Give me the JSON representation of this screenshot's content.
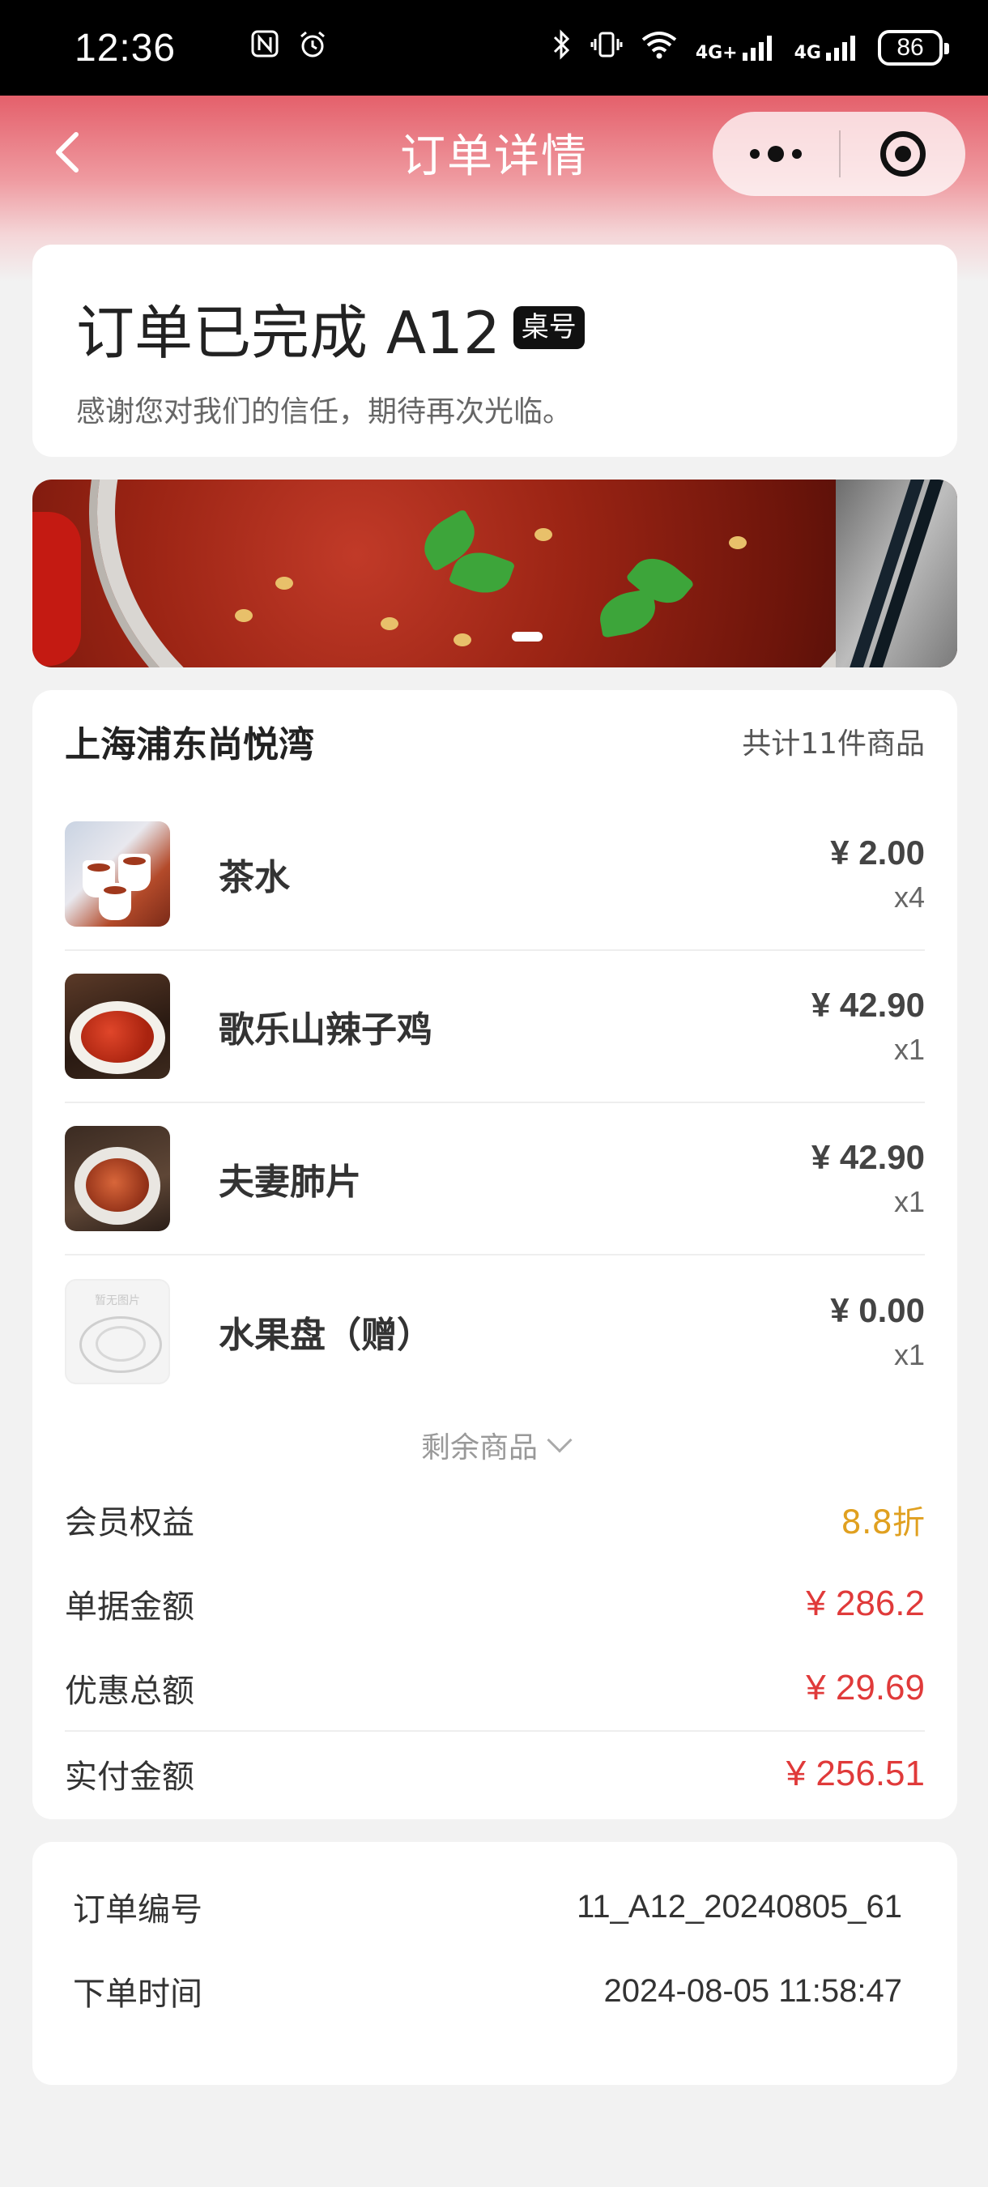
{
  "status_bar": {
    "time": "12:36",
    "battery": "86",
    "signal_labels": [
      "4G+",
      "4G"
    ],
    "icons": [
      "nfc-icon",
      "alarm-icon",
      "bluetooth-icon",
      "vibrate-icon",
      "wifi-icon",
      "signal-icon",
      "battery-icon"
    ]
  },
  "nav": {
    "title": "订单详情"
  },
  "order_status": {
    "title": "订单已完成 A12",
    "table_badge": "桌号",
    "subtitle": "感谢您对我们的信任，期待再次光临。"
  },
  "order": {
    "store_name": "上海浦东尚悦湾",
    "item_count": "共计11件商品",
    "items": [
      {
        "name": "茶水",
        "price": "¥ 2.00",
        "qty": "x4"
      },
      {
        "name": "歌乐山辣子鸡",
        "price": "¥ 42.90",
        "qty": "x1"
      },
      {
        "name": "夫妻肺片",
        "price": "¥ 42.90",
        "qty": "x1"
      },
      {
        "name": "水果盘（赠）",
        "price": "¥ 0.00",
        "qty": "x1",
        "thumb_text": "暂无图片"
      }
    ],
    "more_label": "剩余商品",
    "summary": {
      "member_label": "会员权益",
      "member_value": "8.8折",
      "bill_label": "单据金额",
      "bill_value": "¥ 286.2",
      "discount_label": "优惠总额",
      "discount_value": "¥ 29.69",
      "paid_label": "实付金额",
      "paid_value": "¥ 256.51"
    }
  },
  "info": {
    "order_no_label": "订单编号",
    "order_no": "11_A12_20240805_61",
    "time_label": "下单时间",
    "time": "2024-08-05 11:58:47"
  },
  "colors": {
    "accent_red": "#e03a3a",
    "gold": "#e0a020",
    "header_red": "#e4606b"
  }
}
